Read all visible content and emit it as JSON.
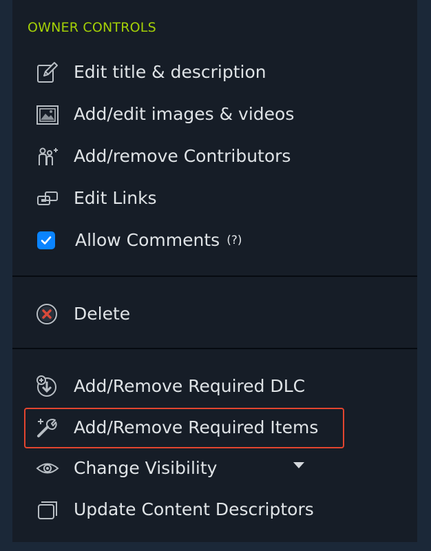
{
  "section_title": "OWNER CONTROLS",
  "items": {
    "edit_title": {
      "label": "Edit title & description",
      "icon": "edit-pencil-icon"
    },
    "add_images": {
      "label": "Add/edit images & videos",
      "icon": "image-icon"
    },
    "contributors": {
      "label": "Add/remove Contributors",
      "icon": "add-people-icon"
    },
    "edit_links": {
      "label": "Edit Links",
      "icon": "link-icon"
    },
    "allow_comments": {
      "label": "Allow Comments",
      "help": "(?)",
      "checked": true,
      "icon": "checkbox-icon"
    },
    "delete": {
      "label": "Delete",
      "icon": "delete-x-circle-icon"
    },
    "required_dlc": {
      "label": "Add/Remove Required DLC",
      "icon": "download-plus-icon"
    },
    "required_items": {
      "label": "Add/Remove Required Items",
      "icon": "wrench-plus-icon",
      "highlighted": true
    },
    "change_visibility": {
      "label": "Change Visibility",
      "icon": "eye-icon",
      "dropdown_icon": "caret-down-icon"
    },
    "content_descriptors": {
      "label": "Update Content Descriptors",
      "icon": "tag-icon"
    }
  },
  "colors": {
    "background": "#1b2838",
    "panel": "#161d27",
    "title": "#a4d007",
    "text": "#dfe3e6",
    "checkbox": "#0a84ff",
    "delete_red": "#d94a3a",
    "highlight": "#e3452f"
  }
}
